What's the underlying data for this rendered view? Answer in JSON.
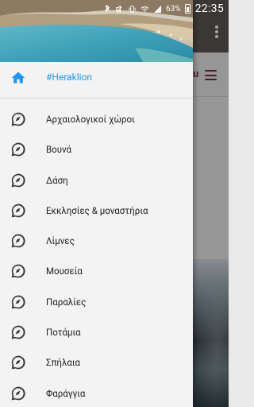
{
  "status_bar": {
    "battery": "63%",
    "time": "22:35"
  },
  "drawer": {
    "header_image": "beach-photo",
    "top_item": {
      "label": "#Heraklion",
      "icon": "home-icon"
    },
    "items": [
      {
        "label": "Αρχαιολογικοί χώροι",
        "icon": "compass-icon"
      },
      {
        "label": "Βουνά",
        "icon": "compass-icon"
      },
      {
        "label": "Δάση",
        "icon": "compass-icon"
      },
      {
        "label": "Εκκλησίες & μοναστήρια",
        "icon": "compass-icon"
      },
      {
        "label": "Λίμνες",
        "icon": "compass-icon"
      },
      {
        "label": "Μουσεία",
        "icon": "compass-icon"
      },
      {
        "label": "Παραλίες",
        "icon": "compass-icon"
      },
      {
        "label": "Ποτάμια",
        "icon": "compass-icon"
      },
      {
        "label": "Σπήλαια",
        "icon": "compass-icon"
      },
      {
        "label": "Φαράγγια",
        "icon": "compass-icon"
      }
    ]
  },
  "background_app": {
    "menu_text": "u"
  },
  "colors": {
    "accent": "#2196f3",
    "brand": "#7a2a44",
    "drawer_bg": "#f3f3f3"
  }
}
